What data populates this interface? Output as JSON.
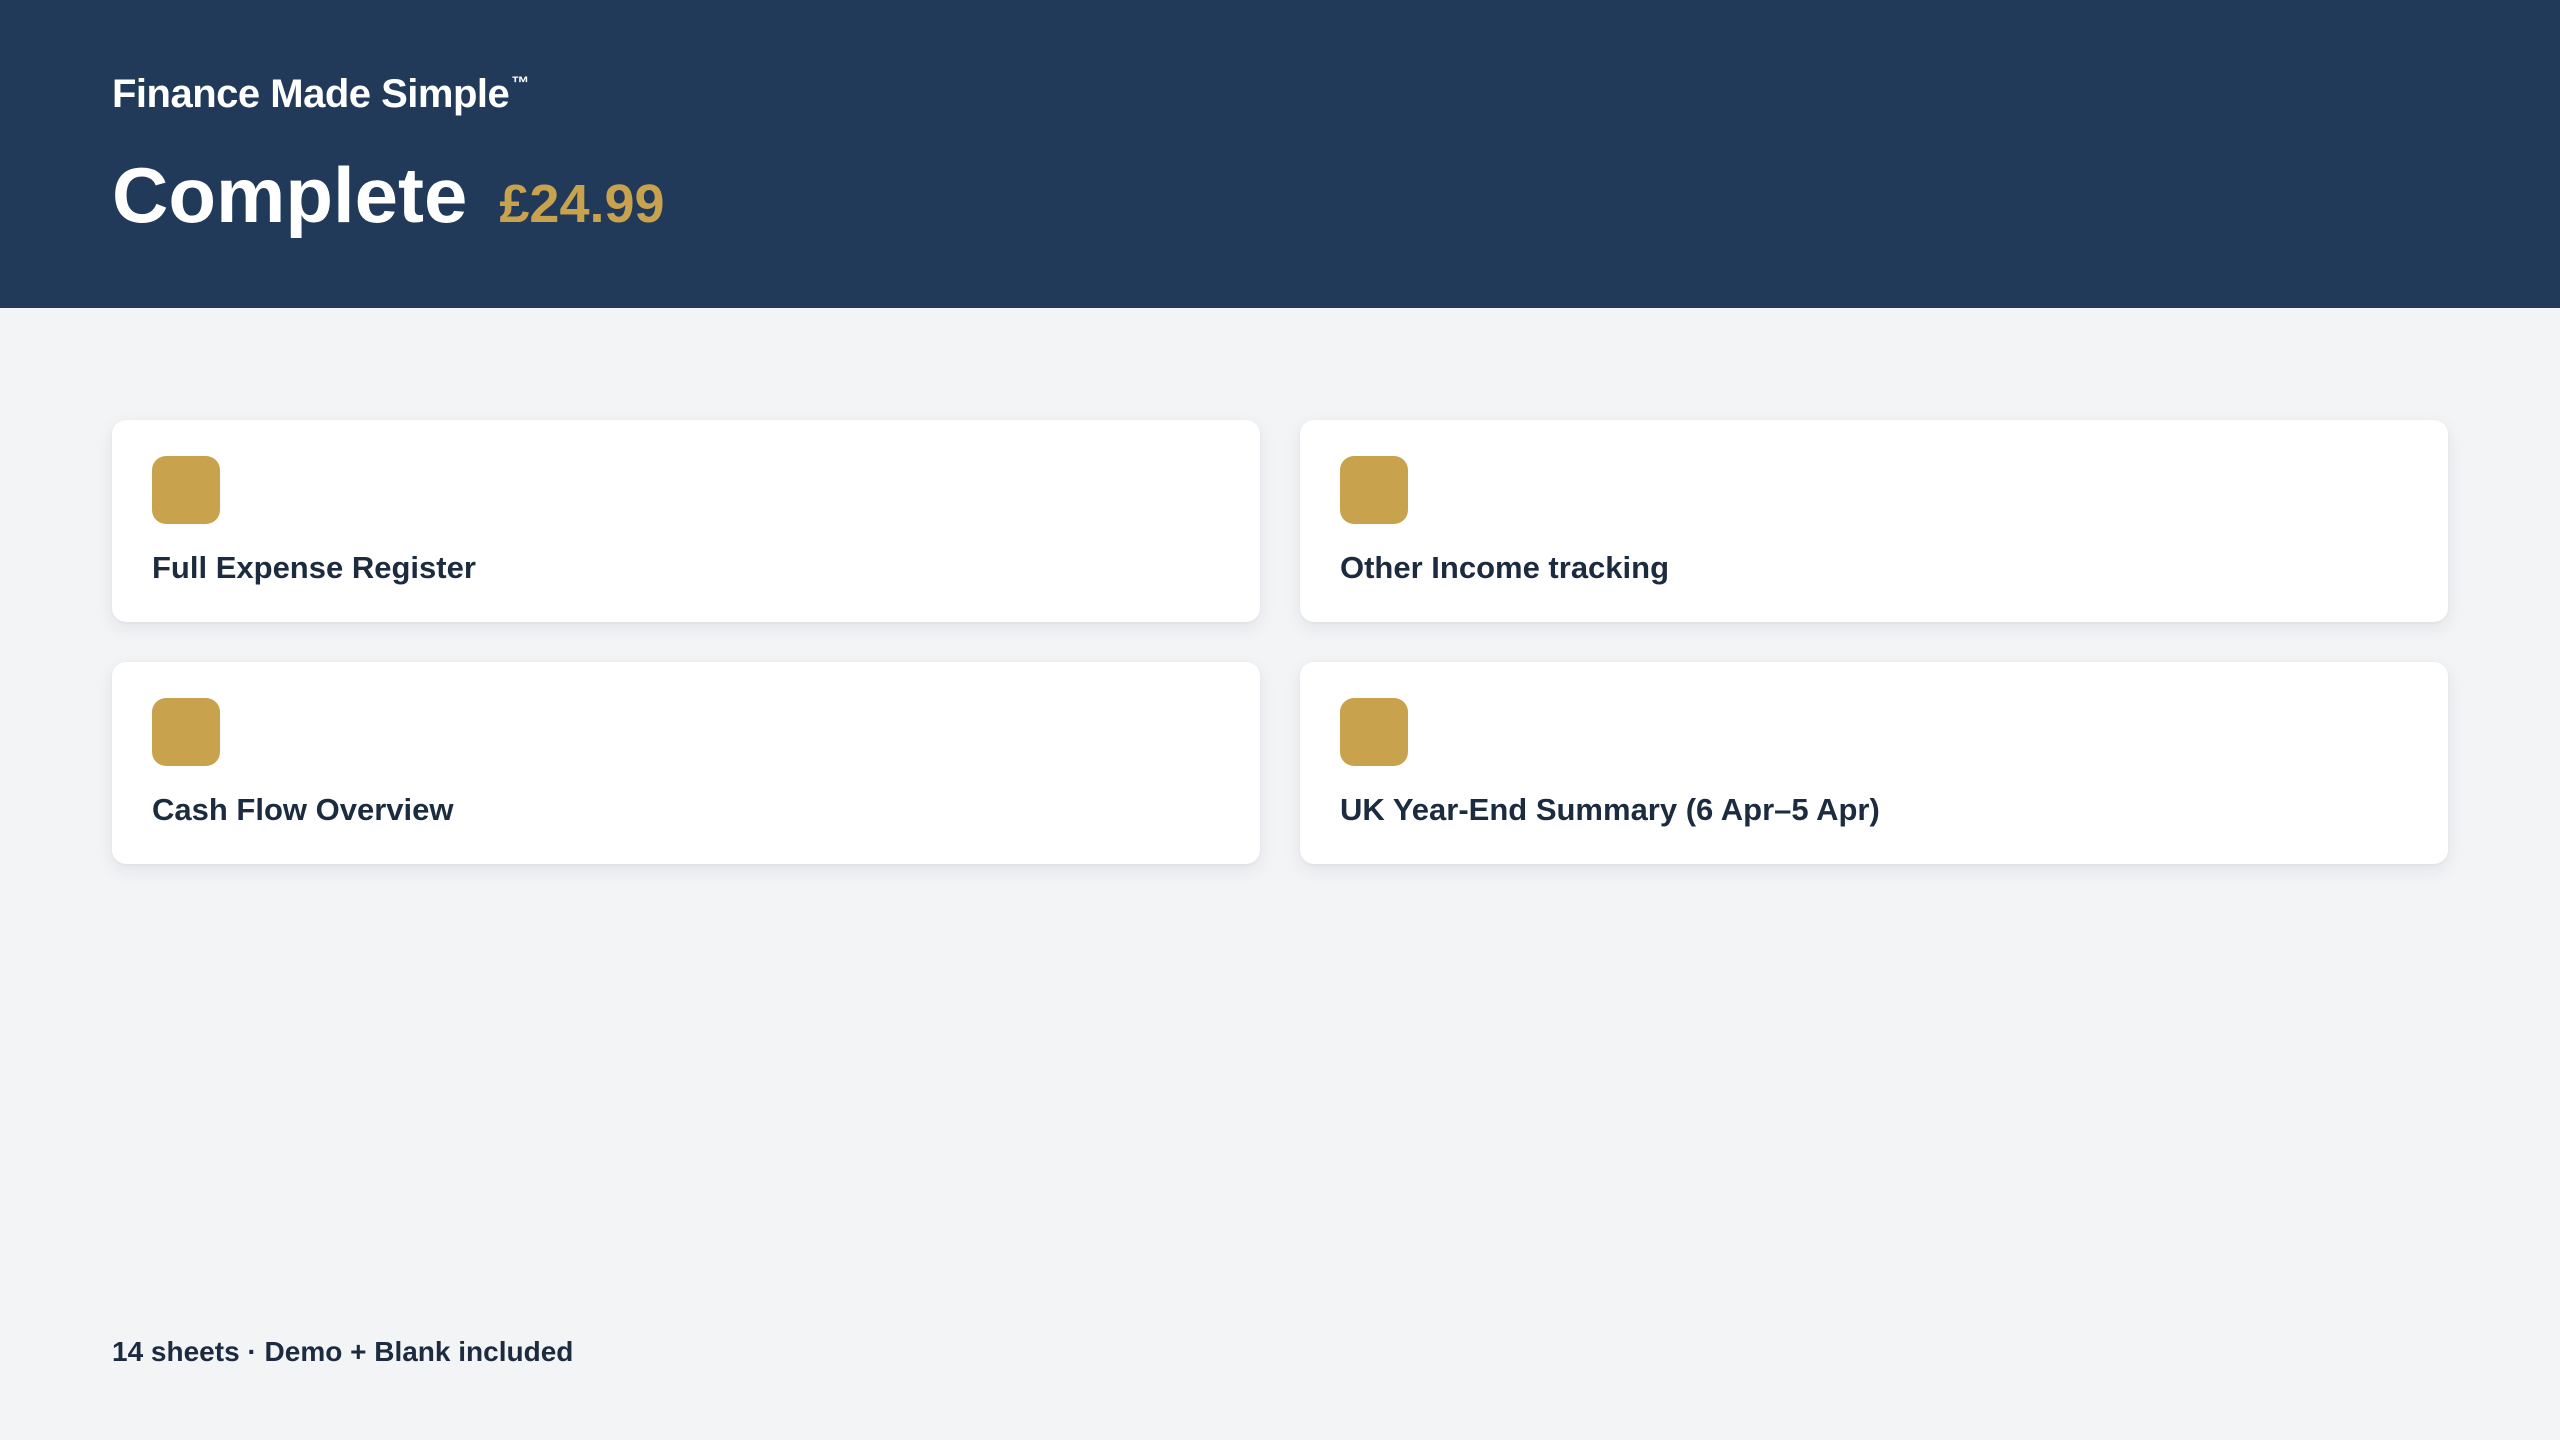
{
  "header": {
    "brand": "Finance Made Simple",
    "trademark": "™",
    "plan_title": "Complete",
    "price": "£24.99"
  },
  "features": [
    {
      "label": "Full Expense Register",
      "icon": "feature-icon"
    },
    {
      "label": "Other Income tracking",
      "icon": "feature-icon"
    },
    {
      "label": "Cash Flow Overview",
      "icon": "feature-icon"
    },
    {
      "label": "UK Year-End Summary (6 Apr–5 Apr)",
      "icon": "feature-icon"
    }
  ],
  "footer": {
    "note": "14 sheets · Demo + Blank included"
  },
  "colors": {
    "header_bg": "#213a59",
    "accent_gold": "#c9a24e",
    "page_bg": "#f3f4f6",
    "text_dark": "#1c2b3f"
  }
}
